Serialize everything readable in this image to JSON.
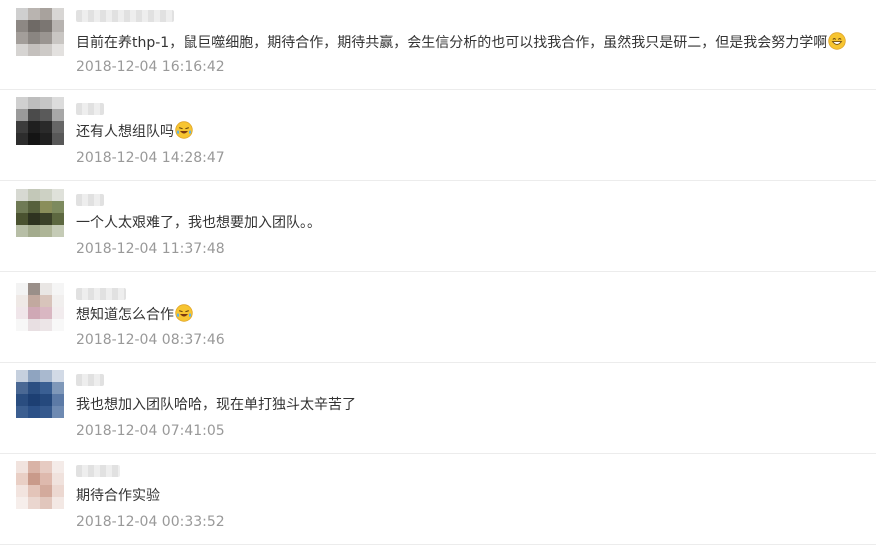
{
  "comments": [
    {
      "text": "目前在养thp-1，鼠巨噬细胞，期待合作，期待共赢，会生信分析的也可以找我合作，虽然我只是研二，但是我会努力学啊",
      "emoji": "grin-emoji",
      "time": "2018-12-04 16:16:42"
    },
    {
      "text": "还有人想组队吗",
      "emoji": "laugh-cry-emoji",
      "time": "2018-12-04 14:28:47"
    },
    {
      "text": "一个人太艰难了，我也想要加入团队。。",
      "emoji": "",
      "time": "2018-12-04 11:37:48"
    },
    {
      "text": "想知道怎么合作",
      "emoji": "laugh-cry-emoji",
      "time": "2018-12-04 08:37:46"
    },
    {
      "text": "我也想加入团队哈哈，现在单打独斗太辛苦了",
      "emoji": "",
      "time": "2018-12-04 07:41:05"
    },
    {
      "text": "期待合作实验",
      "emoji": "",
      "time": "2018-12-04 00:33:52"
    }
  ],
  "colors": {
    "text": "#333333",
    "time": "#999999",
    "divider": "#ececec",
    "emoji_face": "#f7c531"
  }
}
